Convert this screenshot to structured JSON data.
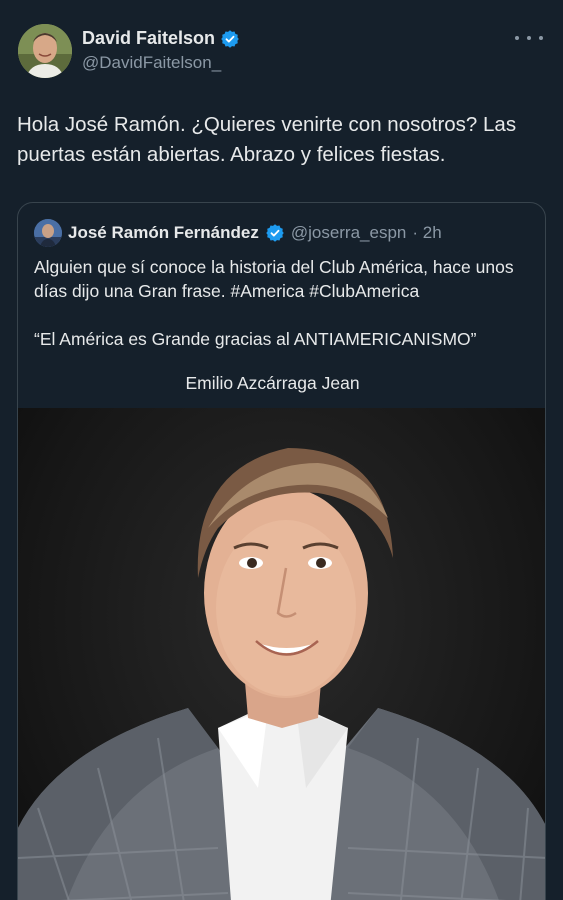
{
  "tweet": {
    "author": {
      "display_name": "David Faitelson",
      "handle": "@DavidFaitelson_",
      "verified_icon": "verified-badge-icon"
    },
    "more_icon": "more-options-icon",
    "text": "Hola José Ramón. ¿Quieres venirte con nosotros? Las puertas están abiertas. Abrazo y felices fiestas."
  },
  "quote": {
    "author": {
      "display_name": "José Ramón Fernández",
      "handle": "@joserra_espn",
      "time": "· 2h"
    },
    "text_line": "Alguien que sí conoce la historia del Club América, hace unos días dijo una Gran frase. #America #ClubAmerica",
    "quote_line": "“El América es Grande gracias al ANTIAMERICANISMO”",
    "attribution": "Emilio Azcárraga Jean"
  },
  "colors": {
    "background": "#15202b",
    "text": "#e7e9ea",
    "muted": "#8b98a5",
    "verified": "#1d9bf0",
    "border": "#38444d"
  }
}
